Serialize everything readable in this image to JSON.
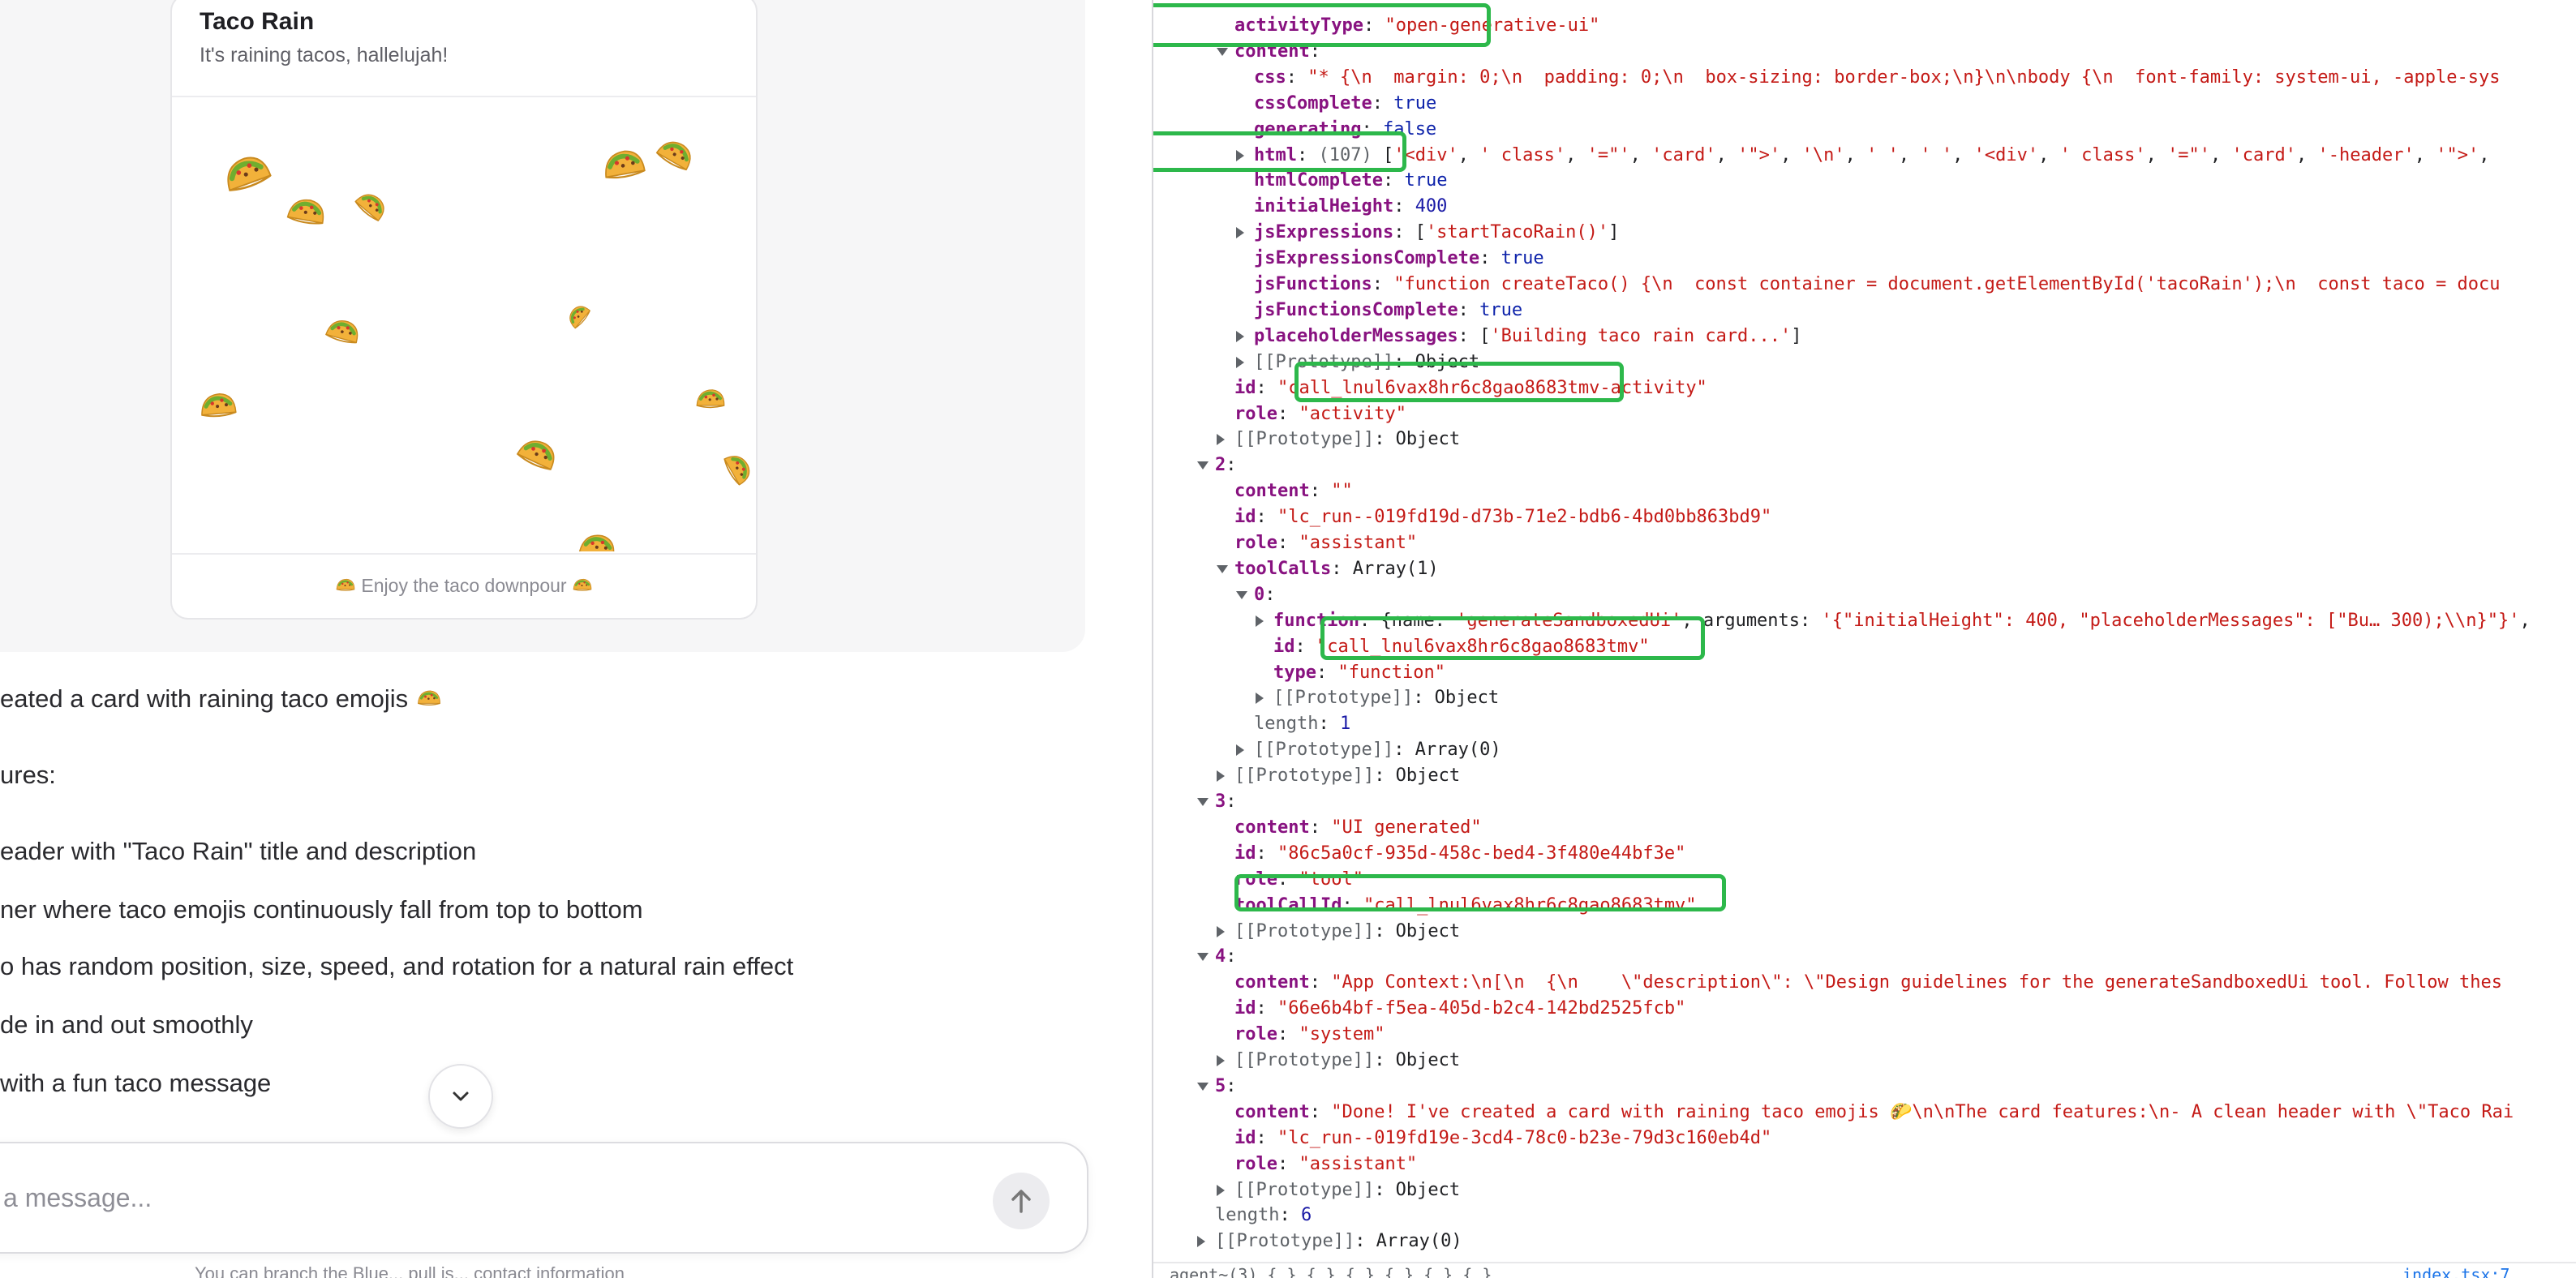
{
  "card": {
    "title": "Taco Rain",
    "subtitle": "It's raining tacos, hallelujah!",
    "footer": "Enjoy the taco downpour"
  },
  "chat": {
    "lines": [
      "eated a card with raining taco emojis",
      "ures:",
      "eader with \"Taco Rain\" title and description",
      "ner where taco emojis continuously fall from top to bottom",
      "o has random position, size, speed, and rotation for a natural rain effect",
      "de in and out smoothly",
      "with a fun taco message"
    ],
    "composer_placeholder": "a message...",
    "disclaimer": "You can branch the Blue... pull is... contact information"
  },
  "devtools": {
    "rows": [
      {
        "indent": 0,
        "arrow": "none",
        "parts": [
          {
            "c": "k",
            "t": "activityType"
          },
          {
            "c": "t",
            "t": ": "
          },
          {
            "c": "s",
            "t": "\"open-generative-ui\""
          }
        ]
      },
      {
        "indent": 0,
        "arrow": "down",
        "parts": [
          {
            "c": "k",
            "t": "content"
          },
          {
            "c": "t",
            "t": ":"
          }
        ]
      },
      {
        "indent": 1,
        "arrow": "none",
        "parts": [
          {
            "c": "k",
            "t": "css"
          },
          {
            "c": "t",
            "t": ": "
          },
          {
            "c": "s",
            "t": "\"* {\\n  margin: 0;\\n  padding: 0;\\n  box-sizing: border-box;\\n}\\n\\nbody {\\n  font-family: system-ui, -apple-sys"
          }
        ]
      },
      {
        "indent": 1,
        "arrow": "none",
        "parts": [
          {
            "c": "k",
            "t": "cssComplete"
          },
          {
            "c": "t",
            "t": ": "
          },
          {
            "c": "b",
            "t": "true"
          }
        ]
      },
      {
        "indent": 1,
        "arrow": "none",
        "parts": [
          {
            "c": "k",
            "t": "generating"
          },
          {
            "c": "t",
            "t": ": "
          },
          {
            "c": "b",
            "t": "false"
          }
        ]
      },
      {
        "indent": 1,
        "arrow": "right",
        "parts": [
          {
            "c": "k",
            "t": "html"
          },
          {
            "c": "t",
            "t": ": "
          },
          {
            "c": "kp",
            "t": "(107)"
          },
          {
            "c": "t",
            "t": " ["
          },
          {
            "c": "s",
            "t": "'<div'"
          },
          {
            "c": "t",
            "t": ", "
          },
          {
            "c": "s",
            "t": "' class'"
          },
          {
            "c": "t",
            "t": ", "
          },
          {
            "c": "s",
            "t": "'=\"'"
          },
          {
            "c": "t",
            "t": ", "
          },
          {
            "c": "s",
            "t": "'card'"
          },
          {
            "c": "t",
            "t": ", "
          },
          {
            "c": "s",
            "t": "'\">'"
          },
          {
            "c": "t",
            "t": ", "
          },
          {
            "c": "s",
            "t": "'\\n'"
          },
          {
            "c": "t",
            "t": ", "
          },
          {
            "c": "s",
            "t": "' '"
          },
          {
            "c": "t",
            "t": ", "
          },
          {
            "c": "s",
            "t": "' '"
          },
          {
            "c": "t",
            "t": ", "
          },
          {
            "c": "s",
            "t": "'<div'"
          },
          {
            "c": "t",
            "t": ", "
          },
          {
            "c": "s",
            "t": "' class'"
          },
          {
            "c": "t",
            "t": ", "
          },
          {
            "c": "s",
            "t": "'=\"'"
          },
          {
            "c": "t",
            "t": ", "
          },
          {
            "c": "s",
            "t": "'card'"
          },
          {
            "c": "t",
            "t": ", "
          },
          {
            "c": "s",
            "t": "'-header'"
          },
          {
            "c": "t",
            "t": ", "
          },
          {
            "c": "s",
            "t": "'\">'"
          },
          {
            "c": "t",
            "t": ","
          }
        ]
      },
      {
        "indent": 1,
        "arrow": "none",
        "parts": [
          {
            "c": "k",
            "t": "htmlComplete"
          },
          {
            "c": "t",
            "t": ": "
          },
          {
            "c": "b",
            "t": "true"
          }
        ]
      },
      {
        "indent": 1,
        "arrow": "none",
        "parts": [
          {
            "c": "k",
            "t": "initialHeight"
          },
          {
            "c": "t",
            "t": ": "
          },
          {
            "c": "n",
            "t": "400"
          }
        ]
      },
      {
        "indent": 1,
        "arrow": "right",
        "parts": [
          {
            "c": "k",
            "t": "jsExpressions"
          },
          {
            "c": "t",
            "t": ": ["
          },
          {
            "c": "s",
            "t": "'startTacoRain()'"
          },
          {
            "c": "t",
            "t": "]"
          }
        ]
      },
      {
        "indent": 1,
        "arrow": "none",
        "parts": [
          {
            "c": "k",
            "t": "jsExpressionsComplete"
          },
          {
            "c": "t",
            "t": ": "
          },
          {
            "c": "b",
            "t": "true"
          }
        ]
      },
      {
        "indent": 1,
        "arrow": "none",
        "parts": [
          {
            "c": "k",
            "t": "jsFunctions"
          },
          {
            "c": "t",
            "t": ": "
          },
          {
            "c": "s",
            "t": "\"function createTaco() {\\n  const container = document.getElementById('tacoRain');\\n  const taco = docu"
          }
        ]
      },
      {
        "indent": 1,
        "arrow": "none",
        "parts": [
          {
            "c": "k",
            "t": "jsFunctionsComplete"
          },
          {
            "c": "t",
            "t": ": "
          },
          {
            "c": "b",
            "t": "true"
          }
        ]
      },
      {
        "indent": 1,
        "arrow": "right",
        "parts": [
          {
            "c": "k",
            "t": "placeholderMessages"
          },
          {
            "c": "t",
            "t": ": ["
          },
          {
            "c": "s",
            "t": "'Building taco rain card...'"
          },
          {
            "c": "t",
            "t": "]"
          }
        ]
      },
      {
        "indent": 1,
        "arrow": "right",
        "parts": [
          {
            "c": "kp",
            "t": "[[Prototype]]"
          },
          {
            "c": "t",
            "t": ": Object"
          }
        ]
      },
      {
        "indent": 0,
        "arrow": "none",
        "parts": [
          {
            "c": "k",
            "t": "id"
          },
          {
            "c": "t",
            "t": ": "
          },
          {
            "c": "s",
            "t": "\"call_lnul6vax8hr6c8gao8683tmv-activity\""
          }
        ]
      },
      {
        "indent": 0,
        "arrow": "none",
        "parts": [
          {
            "c": "k",
            "t": "role"
          },
          {
            "c": "t",
            "t": ": "
          },
          {
            "c": "s",
            "t": "\"activity\""
          }
        ]
      },
      {
        "indent": 0,
        "arrow": "right",
        "parts": [
          {
            "c": "kp",
            "t": "[[Prototype]]"
          },
          {
            "c": "t",
            "t": ": Object"
          }
        ]
      },
      {
        "indent": -1,
        "arrow": "down",
        "parts": [
          {
            "c": "k",
            "t": "2"
          },
          {
            "c": "t",
            "t": ":"
          }
        ]
      },
      {
        "indent": 0,
        "arrow": "none",
        "parts": [
          {
            "c": "k",
            "t": "content"
          },
          {
            "c": "t",
            "t": ": "
          },
          {
            "c": "s",
            "t": "\"\""
          }
        ]
      },
      {
        "indent": 0,
        "arrow": "none",
        "parts": [
          {
            "c": "k",
            "t": "id"
          },
          {
            "c": "t",
            "t": ": "
          },
          {
            "c": "s",
            "t": "\"lc_run--019fd19d-d73b-71e2-bdb6-4bd0bb863bd9\""
          }
        ]
      },
      {
        "indent": 0,
        "arrow": "none",
        "parts": [
          {
            "c": "k",
            "t": "role"
          },
          {
            "c": "t",
            "t": ": "
          },
          {
            "c": "s",
            "t": "\"assistant\""
          }
        ]
      },
      {
        "indent": 0,
        "arrow": "down",
        "parts": [
          {
            "c": "k",
            "t": "toolCalls"
          },
          {
            "c": "t",
            "t": ": Array(1)"
          }
        ]
      },
      {
        "indent": 1,
        "arrow": "down",
        "parts": [
          {
            "c": "k",
            "t": "0"
          },
          {
            "c": "t",
            "t": ":"
          }
        ]
      },
      {
        "indent": 2,
        "arrow": "right",
        "parts": [
          {
            "c": "k",
            "t": "function"
          },
          {
            "c": "t",
            "t": ": {name: "
          },
          {
            "c": "s",
            "t": "'generateSandboxedUi'"
          },
          {
            "c": "t",
            "t": ", arguments: "
          },
          {
            "c": "s",
            "t": "'{\"initialHeight\": 400, \"placeholderMessages\": [\"Bu… 300);\\\\n}\"}'"
          },
          {
            "c": "t",
            "t": ","
          }
        ]
      },
      {
        "indent": 2,
        "arrow": "none",
        "parts": [
          {
            "c": "k",
            "t": "id"
          },
          {
            "c": "t",
            "t": ": "
          },
          {
            "c": "s",
            "t": "\"call_lnul6vax8hr6c8gao8683tmv\""
          }
        ]
      },
      {
        "indent": 2,
        "arrow": "none",
        "parts": [
          {
            "c": "k",
            "t": "type"
          },
          {
            "c": "t",
            "t": ": "
          },
          {
            "c": "s",
            "t": "\"function\""
          }
        ]
      },
      {
        "indent": 2,
        "arrow": "right",
        "parts": [
          {
            "c": "kp",
            "t": "[[Prototype]]"
          },
          {
            "c": "t",
            "t": ": Object"
          }
        ]
      },
      {
        "indent": 1,
        "arrow": "none",
        "parts": [
          {
            "c": "kp",
            "t": "length"
          },
          {
            "c": "t",
            "t": ": "
          },
          {
            "c": "n",
            "t": "1"
          }
        ]
      },
      {
        "indent": 1,
        "arrow": "right",
        "parts": [
          {
            "c": "kp",
            "t": "[[Prototype]]"
          },
          {
            "c": "t",
            "t": ": Array(0)"
          }
        ]
      },
      {
        "indent": 0,
        "arrow": "right",
        "parts": [
          {
            "c": "kp",
            "t": "[[Prototype]]"
          },
          {
            "c": "t",
            "t": ": Object"
          }
        ]
      },
      {
        "indent": -1,
        "arrow": "down",
        "parts": [
          {
            "c": "k",
            "t": "3"
          },
          {
            "c": "t",
            "t": ":"
          }
        ]
      },
      {
        "indent": 0,
        "arrow": "none",
        "parts": [
          {
            "c": "k",
            "t": "content"
          },
          {
            "c": "t",
            "t": ": "
          },
          {
            "c": "s",
            "t": "\"UI generated\""
          }
        ]
      },
      {
        "indent": 0,
        "arrow": "none",
        "parts": [
          {
            "c": "k",
            "t": "id"
          },
          {
            "c": "t",
            "t": ": "
          },
          {
            "c": "s",
            "t": "\"86c5a0cf-935d-458c-bed4-3f480e44bf3e\""
          }
        ]
      },
      {
        "indent": 0,
        "arrow": "none",
        "parts": [
          {
            "c": "k",
            "t": "role"
          },
          {
            "c": "t",
            "t": ": "
          },
          {
            "c": "s",
            "t": "\"tool\""
          }
        ]
      },
      {
        "indent": 0,
        "arrow": "none",
        "parts": [
          {
            "c": "k",
            "t": "toolCallId"
          },
          {
            "c": "t",
            "t": ": "
          },
          {
            "c": "s",
            "t": "\"call_lnul6vax8hr6c8gao8683tmv\""
          }
        ]
      },
      {
        "indent": 0,
        "arrow": "right",
        "parts": [
          {
            "c": "kp",
            "t": "[[Prototype]]"
          },
          {
            "c": "t",
            "t": ": Object"
          }
        ]
      },
      {
        "indent": -1,
        "arrow": "down",
        "parts": [
          {
            "c": "k",
            "t": "4"
          },
          {
            "c": "t",
            "t": ":"
          }
        ]
      },
      {
        "indent": 0,
        "arrow": "none",
        "parts": [
          {
            "c": "k",
            "t": "content"
          },
          {
            "c": "t",
            "t": ": "
          },
          {
            "c": "s",
            "t": "\"App Context:\\n[\\n  {\\n    \\\"description\\\": \\\"Design guidelines for the generateSandboxedUi tool. Follow thes"
          }
        ]
      },
      {
        "indent": 0,
        "arrow": "none",
        "parts": [
          {
            "c": "k",
            "t": "id"
          },
          {
            "c": "t",
            "t": ": "
          },
          {
            "c": "s",
            "t": "\"66e6b4bf-f5ea-405d-b2c4-142bd2525fcb\""
          }
        ]
      },
      {
        "indent": 0,
        "arrow": "none",
        "parts": [
          {
            "c": "k",
            "t": "role"
          },
          {
            "c": "t",
            "t": ": "
          },
          {
            "c": "s",
            "t": "\"system\""
          }
        ]
      },
      {
        "indent": 0,
        "arrow": "right",
        "parts": [
          {
            "c": "kp",
            "t": "[[Prototype]]"
          },
          {
            "c": "t",
            "t": ": Object"
          }
        ]
      },
      {
        "indent": -1,
        "arrow": "down",
        "parts": [
          {
            "c": "k",
            "t": "5"
          },
          {
            "c": "t",
            "t": ":"
          }
        ]
      },
      {
        "indent": 0,
        "arrow": "none",
        "parts": [
          {
            "c": "k",
            "t": "content"
          },
          {
            "c": "t",
            "t": ": "
          },
          {
            "c": "s",
            "t": "\"Done! I've created a card with raining taco emojis 🌮\\n\\nThe card features:\\n- A clean header with \\\"Taco Rai"
          }
        ]
      },
      {
        "indent": 0,
        "arrow": "none",
        "parts": [
          {
            "c": "k",
            "t": "id"
          },
          {
            "c": "t",
            "t": ": "
          },
          {
            "c": "s",
            "t": "\"lc_run--019fd19e-3cd4-78c0-b23e-79d3c160eb4d\""
          }
        ]
      },
      {
        "indent": 0,
        "arrow": "none",
        "parts": [
          {
            "c": "k",
            "t": "role"
          },
          {
            "c": "t",
            "t": ": "
          },
          {
            "c": "s",
            "t": "\"assistant\""
          }
        ]
      },
      {
        "indent": 0,
        "arrow": "right",
        "parts": [
          {
            "c": "kp",
            "t": "[[Prototype]]"
          },
          {
            "c": "t",
            "t": ": Object"
          }
        ]
      },
      {
        "indent": -1,
        "arrow": "none",
        "parts": [
          {
            "c": "kp",
            "t": "length"
          },
          {
            "c": "t",
            "t": ": "
          },
          {
            "c": "n",
            "t": "6"
          }
        ]
      },
      {
        "indent": -1,
        "arrow": "right",
        "parts": [
          {
            "c": "kp",
            "t": "[[Prototype]]"
          },
          {
            "c": "t",
            "t": ": Array(0)"
          }
        ]
      }
    ],
    "bottom_left": "agent~(3) {…} {…} {…} {…} {…} {…}",
    "bottom_right": "index.tsx:7"
  },
  "colors": {
    "highlight": "#2db84b",
    "key": "#881280",
    "string": "#c41a16",
    "number": "#1a1aa6"
  }
}
